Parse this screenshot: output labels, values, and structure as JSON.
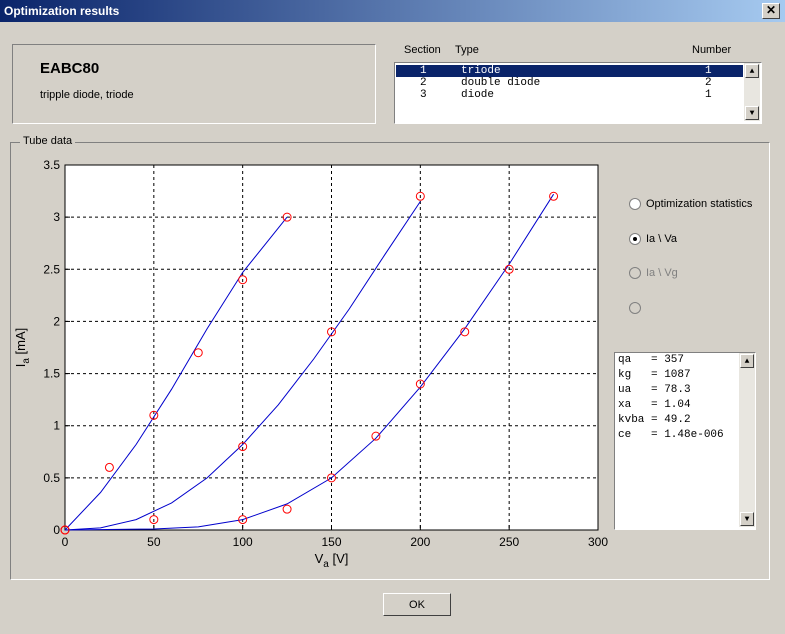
{
  "window": {
    "title": "Optimization results",
    "close_label": "✕"
  },
  "tube": {
    "name": "EABC80",
    "description": "tripple diode, triode"
  },
  "sections": {
    "headers": {
      "section": "Section",
      "type": "Type",
      "number": "Number"
    },
    "rows": [
      {
        "section": "1",
        "type": "triode",
        "number": "1",
        "selected": true
      },
      {
        "section": "2",
        "type": "double diode",
        "number": "2",
        "selected": false
      },
      {
        "section": "3",
        "type": "diode",
        "number": "1",
        "selected": false
      }
    ]
  },
  "group_label": "Tube data",
  "options": [
    {
      "label": "Optimization statistics",
      "checked": false,
      "enabled": true
    },
    {
      "label": "Ia \\ Va",
      "checked": true,
      "enabled": true
    },
    {
      "label": "Ia \\ Vg",
      "checked": false,
      "enabled": false
    },
    {
      "label": "",
      "checked": false,
      "enabled": false
    }
  ],
  "stats": [
    "qa   = 357",
    "kg   = 1087",
    "ua   = 78.3",
    "xa   = 1.04",
    "kvba = 49.2",
    "ce   = 1.48e-006"
  ],
  "ok_label": "OK",
  "chart_data": {
    "type": "scatter",
    "xlabel": "Va [V]",
    "ylabel": "Ia [mA]",
    "xlim": [
      0,
      300
    ],
    "ylim": [
      0,
      3.5
    ],
    "xticks": [
      0,
      50,
      100,
      150,
      200,
      250,
      300
    ],
    "yticks": [
      0,
      0.5,
      1,
      1.5,
      2,
      2.5,
      3,
      3.5
    ],
    "grid": true,
    "colors": {
      "points": "#ff0000",
      "curves": "#0000cc"
    },
    "series": [
      {
        "points": [
          [
            0,
            0
          ],
          [
            25,
            0.6
          ],
          [
            50,
            1.1
          ],
          [
            75,
            1.7
          ],
          [
            100,
            2.4
          ],
          [
            125,
            3.0
          ]
        ],
        "curve": [
          [
            0,
            0
          ],
          [
            20,
            0.36
          ],
          [
            40,
            0.82
          ],
          [
            60,
            1.35
          ],
          [
            80,
            1.93
          ],
          [
            100,
            2.47
          ],
          [
            125,
            3.0
          ]
        ]
      },
      {
        "points": [
          [
            0,
            0
          ],
          [
            50,
            0.1
          ],
          [
            100,
            0.8
          ],
          [
            150,
            1.9
          ],
          [
            200,
            3.2
          ]
        ],
        "curve": [
          [
            0,
            0
          ],
          [
            20,
            0.02
          ],
          [
            40,
            0.1
          ],
          [
            60,
            0.26
          ],
          [
            80,
            0.5
          ],
          [
            100,
            0.82
          ],
          [
            120,
            1.2
          ],
          [
            140,
            1.64
          ],
          [
            160,
            2.12
          ],
          [
            180,
            2.64
          ],
          [
            200,
            3.15
          ]
        ]
      },
      {
        "points": [
          [
            0,
            0
          ],
          [
            100,
            0.1
          ],
          [
            125,
            0.2
          ],
          [
            150,
            0.5
          ],
          [
            175,
            0.9
          ],
          [
            200,
            1.4
          ],
          [
            225,
            1.9
          ],
          [
            250,
            2.5
          ],
          [
            275,
            3.2
          ]
        ],
        "curve": [
          [
            0,
            0
          ],
          [
            50,
            0.01
          ],
          [
            75,
            0.03
          ],
          [
            100,
            0.1
          ],
          [
            125,
            0.25
          ],
          [
            150,
            0.5
          ],
          [
            175,
            0.88
          ],
          [
            200,
            1.37
          ],
          [
            225,
            1.93
          ],
          [
            250,
            2.55
          ],
          [
            275,
            3.22
          ]
        ]
      }
    ]
  }
}
